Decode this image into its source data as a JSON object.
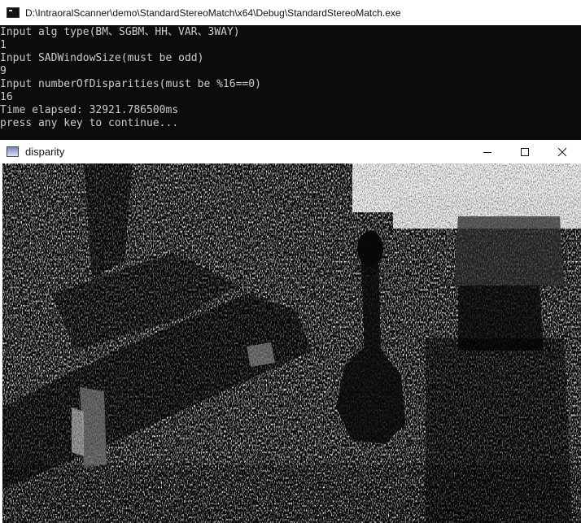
{
  "console": {
    "title": "D:\\IntraoralScanner\\demo\\StandardStereoMatch\\x64\\Debug\\StandardStereoMatch.exe",
    "lines": [
      "Input alg type(BM、SGBM、HH、VAR、3WAY)",
      "1",
      "Input SADWindowSize(must be odd)",
      "9",
      "Input numberOfDisparities(must be %16==0)",
      "16",
      "Time elapsed: 32921.786500ms",
      "press any key to continue..."
    ]
  },
  "image_window": {
    "title": "disparity",
    "controls": {
      "minimize_icon": "minimize-icon",
      "maximize_icon": "maximize-icon",
      "close_icon": "close-icon"
    }
  },
  "colors": {
    "console_bg": "#0c0c0c",
    "console_text": "#cccccc",
    "titlebar_bg": "#ffffff"
  }
}
